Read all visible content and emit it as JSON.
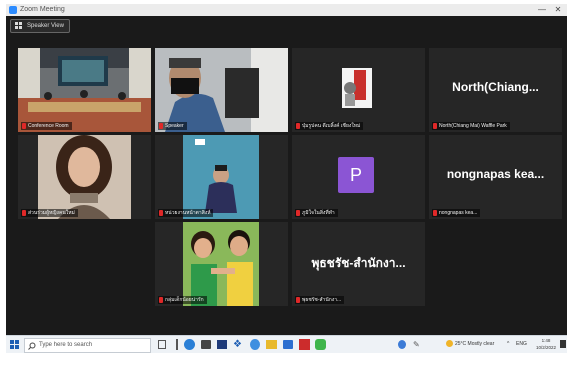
{
  "window": {
    "title": "Zoom Meeting",
    "min_glyph": "—",
    "close_glyph": "✕"
  },
  "view_button": {
    "label": "Speaker View"
  },
  "tiles": [
    {
      "name": "Conference Room"
    },
    {
      "name": "Speaker"
    },
    {
      "name": "ปุ่มรูปคน ดีเบลิ้งค์ เชียงใหม่"
    },
    {
      "name": "North(Chiang Mai) Waffle Park",
      "display": "North(Chiang..."
    },
    {
      "name": "ส่วนร่วมผู้หญิงคนใหม่"
    },
    {
      "name": "หน่วยงานหน้าตาสิงห์"
    },
    {
      "name": "ภูมิใจในสิ่งที่ทำ"
    },
    {
      "name": "nongnapas kea...",
      "display": "nongnapas kea..."
    },
    {
      "name": "กลุ่มเด็กน้อยน่ารัก"
    },
    {
      "name": "พุธชรัช-สำนักงา...",
      "display": "พุธชรัช-สำนักงา..."
    }
  ],
  "avatar_letter": "P",
  "taskbar": {
    "search_placeholder": "Type here to search",
    "weather": "25°C Mostly clear",
    "language": "ENG",
    "time": "1:48",
    "date": "10/2/2022"
  }
}
